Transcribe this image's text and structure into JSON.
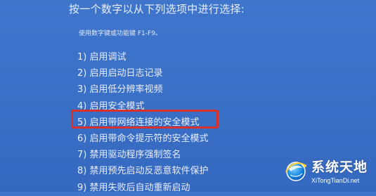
{
  "screen": {
    "prompt": "按一个数字以从下列选项中进行选择:",
    "hint": "使用数字键或功能键 F1-F9。",
    "options": [
      "1) 启用调试",
      "2) 启用启动日志记录",
      "3) 启用低分辨率视频",
      "4) 启用安全模式",
      "5) 启用带网络连接的安全模式",
      "6) 启用带命令提示符的安全模式",
      "7) 禁用驱动程序强制签名",
      "8) 禁用预先启动反恶意软件保护",
      "9) 禁用失败后自动重新启动"
    ],
    "highlighted_option_index": 4
  },
  "watermark": {
    "title": "系统天地",
    "url": "XiTongTianDi.net",
    "icon": "globe-logo-icon"
  },
  "colors": {
    "background": "#3a6fc6",
    "text": "#e9eefc",
    "highlight": "#d8312b"
  }
}
